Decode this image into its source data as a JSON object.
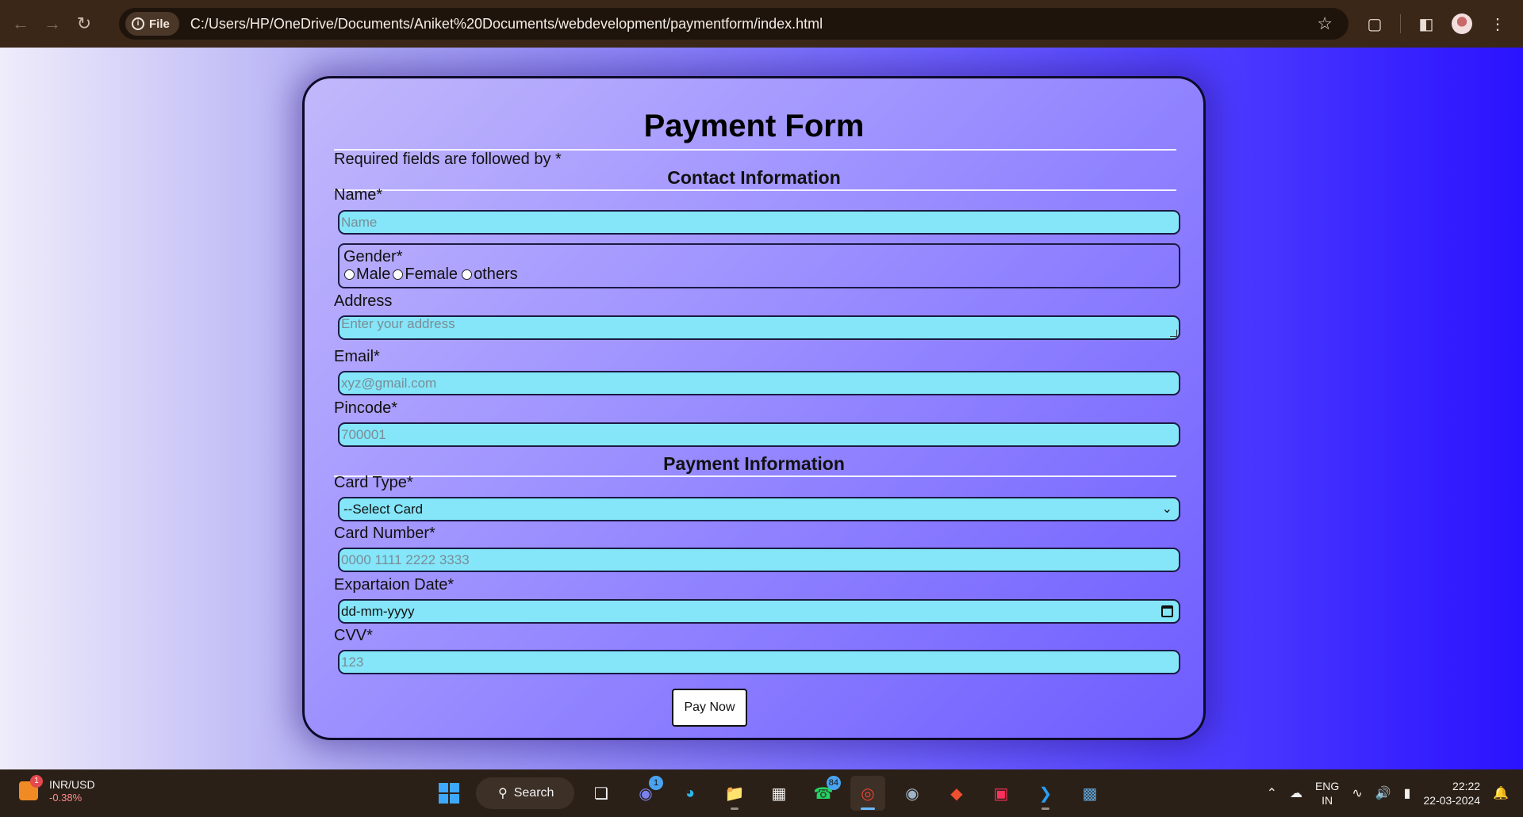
{
  "browser": {
    "file_chip": "File",
    "url": "C:/Users/HP/OneDrive/Documents/Aniket%20Documents/webdevelopment/paymentform/index.html"
  },
  "form": {
    "title": "Payment Form",
    "required_note": "Required fields are followed by *",
    "contact_section": "Contact Information",
    "name_label": "Name*",
    "name_placeholder": "Name",
    "gender_label": "Gender*",
    "gender_options": [
      "Male",
      "Female",
      "others"
    ],
    "address_label": "Address",
    "address_placeholder": "Enter your address",
    "email_label": "Email*",
    "email_placeholder": "xyz@gmail.com",
    "pincode_label": "Pincode*",
    "pincode_placeholder": "700001",
    "payment_section": "Payment Information",
    "card_type_label": "Card Type*",
    "card_type_selected": "--Select Card",
    "card_number_label": "Card Number*",
    "card_number_placeholder": "0000 1111 2222 3333",
    "expiry_label": "Expartaion Date*",
    "expiry_placeholder": "dd-mm-yyyy",
    "cvv_label": "CVV*",
    "cvv_placeholder": "123",
    "submit_label": "Pay Now"
  },
  "taskbar": {
    "ticker_badge": "1",
    "ticker_symbol": "INR/USD",
    "ticker_change": "-0.38%",
    "search_label": "Search",
    "teams_badge": "1",
    "whatsapp_badge": "84",
    "lang_line1": "ENG",
    "lang_line2": "IN",
    "time": "22:22",
    "date": "22-03-2024"
  }
}
